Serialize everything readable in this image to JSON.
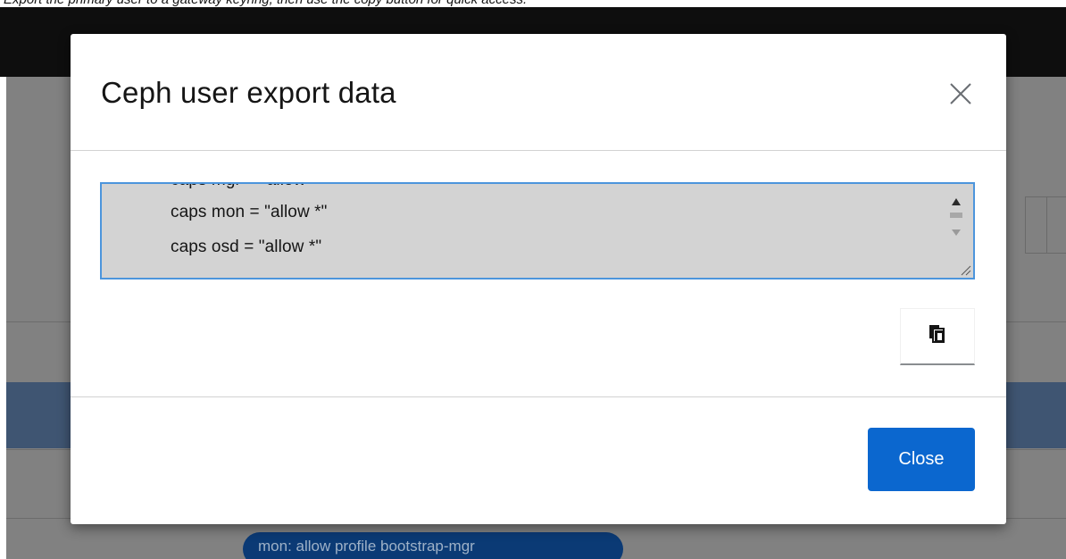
{
  "background": {
    "caption": "Export the primary user to a gateway keyring, then use the copy button for quick access.",
    "badge": "mon: allow profile bootstrap-mgr"
  },
  "modal": {
    "title": "Ceph user export data",
    "close_icon": "close-icon",
    "export_text": {
      "partial_line": "caps mgr = \"allow *\"",
      "lines": [
        "caps mon = \"allow *\"",
        "caps osd = \"allow *\""
      ]
    },
    "copy_icon": "clipboard-icon",
    "close_button_label": "Close"
  },
  "colors": {
    "primary": "#0b67cf",
    "focus_border": "#4c95dc",
    "textarea_bg": "#d3d3d3",
    "badge_bg": "#0b3a75"
  }
}
